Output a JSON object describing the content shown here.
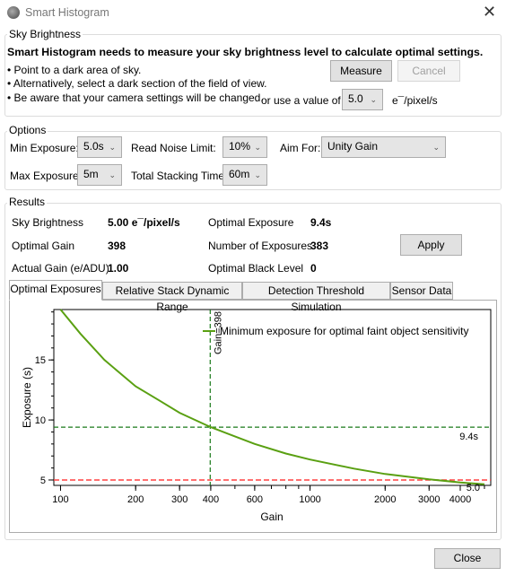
{
  "window": {
    "title": "Smart Histogram",
    "close_icon": "close-icon"
  },
  "sky": {
    "group_label": "Sky Brightness",
    "heading": "Smart Histogram needs to measure your sky brightness level to calculate optimal settings.",
    "bullets": [
      "• Point to a dark area of sky.",
      "• Alternatively, select a dark section of the field of view.",
      "• Be aware that your camera settings will be changed."
    ],
    "measure_label": "Measure",
    "cancel_label": "Cancel",
    "use_value_label": "or use a value of",
    "value": "5.0",
    "unit": "e¯/pixel/s"
  },
  "options": {
    "group_label": "Options",
    "min_exposure_label": "Min Exposure:",
    "min_exposure": "5.0s",
    "max_exposure_label": "Max Exposure:",
    "max_exposure": "5m",
    "read_noise_label": "Read Noise Limit:",
    "read_noise": "10%",
    "stacking_label": "Total Stacking Time:",
    "stacking": "60m",
    "aim_label": "Aim For:",
    "aim": "Unity Gain"
  },
  "results": {
    "group_label": "Results",
    "sky_brightness_label": "Sky Brightness",
    "sky_brightness": "5.00 e¯/pixel/s",
    "optimal_gain_label": "Optimal Gain",
    "optimal_gain": "398",
    "actual_gain_label": "Actual Gain (e/ADU)",
    "actual_gain": "1.00",
    "optimal_exposure_label": "Optimal Exposure",
    "optimal_exposure": "9.4s",
    "num_exposures_label": "Number of Exposures",
    "num_exposures": "383",
    "black_level_label": "Optimal Black Level",
    "black_level": "0",
    "apply_label": "Apply"
  },
  "tabs": [
    {
      "label": "Optimal Exposures",
      "active": true
    },
    {
      "label": "Relative Stack Dynamic Range",
      "active": false
    },
    {
      "label": "Detection Threshold Simulation",
      "active": false
    },
    {
      "label": "Sensor Data",
      "active": false
    }
  ],
  "chart_data": {
    "type": "line",
    "xlabel": "Gain",
    "ylabel": "Exposure (s)",
    "x_scale": "log",
    "xlim": [
      94,
      5300
    ],
    "ylim": [
      4.55,
      19.2
    ],
    "x_ticks": [
      "100",
      "200",
      "300",
      "400",
      "600",
      "1000",
      "2000",
      "3000",
      "4000"
    ],
    "x_tick_values": [
      100,
      200,
      300,
      400,
      600,
      1000,
      2000,
      3000,
      4000
    ],
    "y_ticks": [
      "5",
      "10",
      "15"
    ],
    "y_tick_values": [
      5,
      10,
      15
    ],
    "series": [
      {
        "name": "Minimum exposure for optimal faint object sensitivity",
        "color": "#5aa012",
        "x": [
          100,
          120,
          150,
          200,
          250,
          300,
          400,
          600,
          800,
          1000,
          1500,
          2000,
          3000,
          4000,
          5000
        ],
        "y": [
          19.2,
          17.2,
          15.0,
          12.8,
          11.6,
          10.6,
          9.4,
          8.0,
          7.2,
          6.7,
          5.95,
          5.5,
          5.05,
          4.8,
          4.65
        ]
      }
    ],
    "annotations": [
      {
        "type": "vline",
        "x": 398,
        "label": "Gain=398",
        "color": "#1a7a1a"
      },
      {
        "type": "hline",
        "y": 9.4,
        "label": "9.4s",
        "color": "#1a7a1a"
      },
      {
        "type": "hline",
        "y": 5.0,
        "label": "5.0",
        "color": "#ff4040"
      }
    ],
    "legend": "top-right",
    "grid": false
  },
  "footer": {
    "close_label": "Close"
  }
}
